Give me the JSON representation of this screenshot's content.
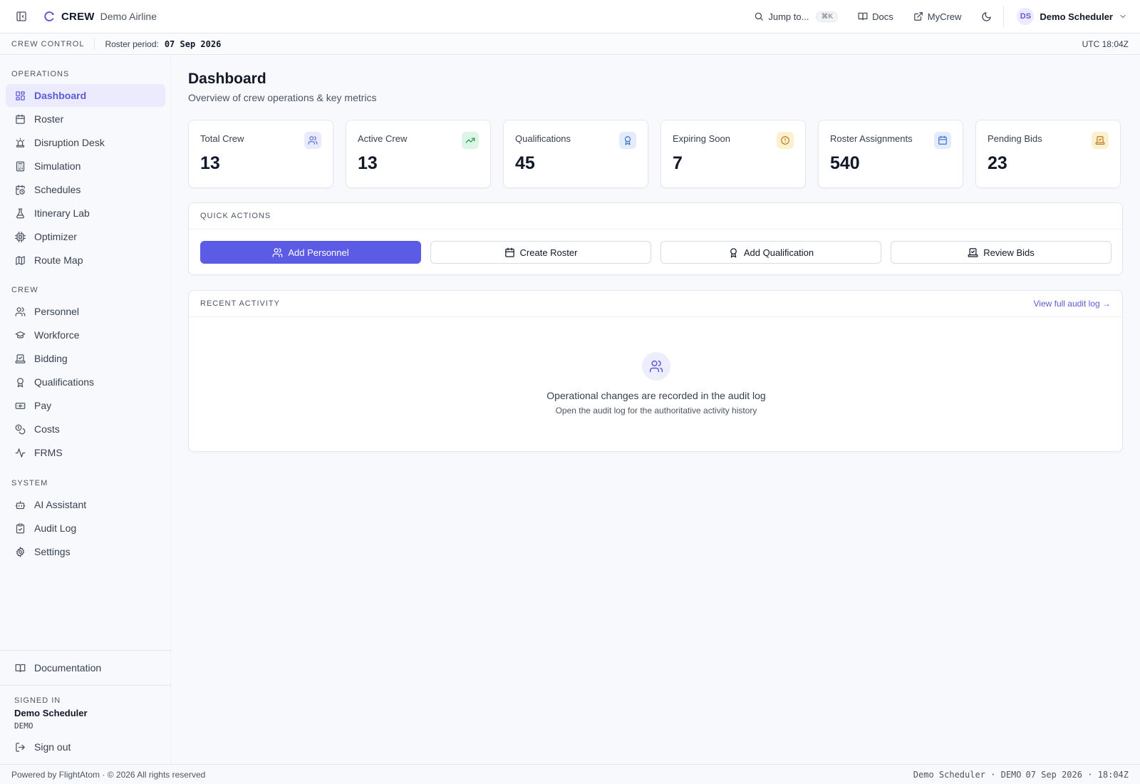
{
  "header": {
    "brand_name": "CREW",
    "airline": "Demo Airline",
    "jump_label": "Jump to...",
    "jump_shortcut": "⌘K",
    "docs_label": "Docs",
    "mycrew_label": "MyCrew",
    "user_initials": "DS",
    "user_name": "Demo Scheduler"
  },
  "subbar": {
    "context": "CREW CONTROL",
    "period_label": "Roster period:",
    "period_value": "07 Sep 2026",
    "utc_time": "UTC 18:04Z"
  },
  "sidebar": {
    "sections": [
      {
        "label": "OPERATIONS"
      },
      {
        "label": "CREW"
      },
      {
        "label": "SYSTEM"
      }
    ],
    "items": [
      {
        "label": "Dashboard",
        "icon": "dashboard-icon",
        "active": true
      },
      {
        "label": "Roster",
        "icon": "calendar-icon"
      },
      {
        "label": "Disruption Desk",
        "icon": "siren-icon"
      },
      {
        "label": "Simulation",
        "icon": "calculator-icon"
      },
      {
        "label": "Schedules",
        "icon": "calendar-clock-icon"
      },
      {
        "label": "Itinerary Lab",
        "icon": "flask-icon"
      },
      {
        "label": "Optimizer",
        "icon": "cpu-icon"
      },
      {
        "label": "Route Map",
        "icon": "map-icon"
      },
      {
        "label": "Personnel",
        "icon": "users-icon"
      },
      {
        "label": "Workforce",
        "icon": "graduation-cap-icon"
      },
      {
        "label": "Bidding",
        "icon": "ballot-icon"
      },
      {
        "label": "Qualifications",
        "icon": "award-icon"
      },
      {
        "label": "Pay",
        "icon": "banknote-icon"
      },
      {
        "label": "Costs",
        "icon": "coins-icon"
      },
      {
        "label": "FRMS",
        "icon": "activity-icon"
      },
      {
        "label": "AI Assistant",
        "icon": "bot-icon"
      },
      {
        "label": "Audit Log",
        "icon": "clipboard-check-icon"
      },
      {
        "label": "Settings",
        "icon": "gear-icon"
      },
      {
        "label": "Documentation",
        "icon": "book-icon"
      },
      {
        "label": "Sign out",
        "icon": "log-out-icon"
      }
    ],
    "signed_in_label": "SIGNED IN",
    "signed_in_name": "Demo Scheduler",
    "signed_in_role": "DEMO"
  },
  "page": {
    "title": "Dashboard",
    "subtitle": "Overview of crew operations & key metrics"
  },
  "stats": [
    {
      "label": "Total Crew",
      "value": "13",
      "icon": "users-icon",
      "color": "#5b6bd6"
    },
    {
      "label": "Active Crew",
      "value": "13",
      "icon": "trending-up-icon",
      "color": "#22a05a"
    },
    {
      "label": "Qualifications",
      "value": "45",
      "icon": "award-icon",
      "color": "#3b6fd4"
    },
    {
      "label": "Expiring Soon",
      "value": "7",
      "icon": "alert-circle-icon",
      "color": "#b7791f"
    },
    {
      "label": "Roster Assignments",
      "value": "540",
      "icon": "calendar-icon",
      "color": "#3b6fd4"
    },
    {
      "label": "Pending Bids",
      "value": "23",
      "icon": "ballot-icon",
      "color": "#b7791f"
    }
  ],
  "quick_actions": {
    "title": "QUICK ACTIONS",
    "buttons": [
      {
        "label": "Add Personnel",
        "icon": "users-icon"
      },
      {
        "label": "Create Roster",
        "icon": "calendar-icon"
      },
      {
        "label": "Add Qualification",
        "icon": "award-icon"
      },
      {
        "label": "Review Bids",
        "icon": "ballot-icon"
      }
    ]
  },
  "recent_activity": {
    "title": "RECENT ACTIVITY",
    "link": "View full audit log →",
    "empty_title": "Operational changes are recorded in the audit log",
    "empty_sub": "Open the audit log for the authoritative activity history"
  },
  "footer": {
    "left": "Powered by FlightAtom · © 2026 All rights reserved",
    "right_user": "Demo Scheduler · DEMO",
    "right_time": "07 Sep 2026 · 18:04Z"
  },
  "colors": {
    "accent": "#5b5be6",
    "active_nav_bg": "#eceafd"
  }
}
